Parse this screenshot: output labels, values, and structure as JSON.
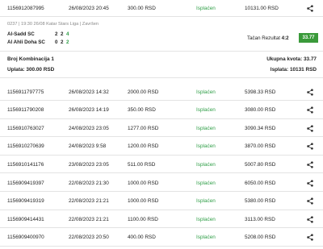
{
  "first_ticket": {
    "id": "1156912087995",
    "date": "26/08/2023 20:45",
    "stake": "300.00 RSD",
    "status": "Isplaćen",
    "payout": "10131.00 RSD"
  },
  "detail": {
    "meta": "0237 | 19:30 26/08 Katar Stars Liga | Završen",
    "home_team": "Al-Sadd SC",
    "away_team": "Al Ahli Doha SC",
    "home_scores": [
      "2",
      "2",
      "4"
    ],
    "away_scores": [
      "0",
      "2",
      "2"
    ],
    "result_label": "Tačan Rezultat",
    "result_value": "4:2",
    "odd": "33.77",
    "combination_label": "Broj Kombinacija 1",
    "payment_label": "Uplata: 300.00 RSD",
    "total_odds_label": "Ukupna kvota: 33.77",
    "payout_label": "Isplata: 10131 RSD"
  },
  "tickets": [
    {
      "id": "1156911797775",
      "date": "26/08/2023 14:32",
      "stake": "2000.00 RSD",
      "status": "Isplaćen",
      "payout": "5398.33 RSD"
    },
    {
      "id": "1156911790208",
      "date": "26/08/2023 14:19",
      "stake": "350.00 RSD",
      "status": "Isplaćen",
      "payout": "3080.00 RSD"
    },
    {
      "id": "1156910763027",
      "date": "24/08/2023 23:05",
      "stake": "1277.00 RSD",
      "status": "Isplaćen",
      "payout": "3090.34 RSD"
    },
    {
      "id": "1156910270639",
      "date": "24/08/2023 9:58",
      "stake": "1200.00 RSD",
      "status": "Isplaćen",
      "payout": "3870.00 RSD"
    },
    {
      "id": "1156910141176",
      "date": "23/08/2023 23:05",
      "stake": "511.00 RSD",
      "status": "Isplaćen",
      "payout": "5007.80 RSD"
    },
    {
      "id": "1156909419397",
      "date": "22/08/2023 21:30",
      "stake": "1000.00 RSD",
      "status": "Isplaćen",
      "payout": "6050.00 RSD"
    },
    {
      "id": "1156909419319",
      "date": "22/08/2023 21:21",
      "stake": "1000.00 RSD",
      "status": "Isplaćen",
      "payout": "5380.00 RSD"
    },
    {
      "id": "1156909414431",
      "date": "22/08/2023 21:21",
      "stake": "1100.00 RSD",
      "status": "Isplaćen",
      "payout": "3113.00 RSD"
    },
    {
      "id": "1156909400970",
      "date": "22/08/2023 20:50",
      "stake": "400.00 RSD",
      "status": "Isplaćen",
      "payout": "5208.00 RSD"
    }
  ],
  "icons": {
    "share": "share-icon"
  },
  "colors": {
    "status_green": "#2f9e47",
    "odd_badge": "#3a9a3a"
  }
}
